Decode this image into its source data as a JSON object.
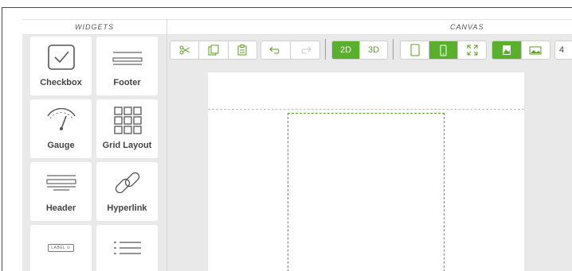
{
  "widgets": {
    "title": "WIDGETS",
    "items": [
      {
        "label": "Checkbox",
        "icon": "checkbox-icon"
      },
      {
        "label": "Footer",
        "icon": "footer-icon"
      },
      {
        "label": "Gauge",
        "icon": "gauge-icon"
      },
      {
        "label": "Grid Layout",
        "icon": "grid-layout-icon"
      },
      {
        "label": "Header",
        "icon": "header-icon"
      },
      {
        "label": "Hyperlink",
        "icon": "hyperlink-icon"
      },
      {
        "label": "",
        "icon": "label-icon",
        "icon_text": "LABEL ⊙"
      },
      {
        "label": "",
        "icon": "list-icon"
      }
    ]
  },
  "canvas": {
    "title": "CANVAS",
    "toolbar": {
      "view_2d": "2D",
      "view_3d": "3D",
      "overflow_text": "4"
    }
  },
  "colors": {
    "accent": "#5ab02c",
    "icon_green": "#5a9e1f",
    "panel_bg": "#e9e9e9"
  }
}
